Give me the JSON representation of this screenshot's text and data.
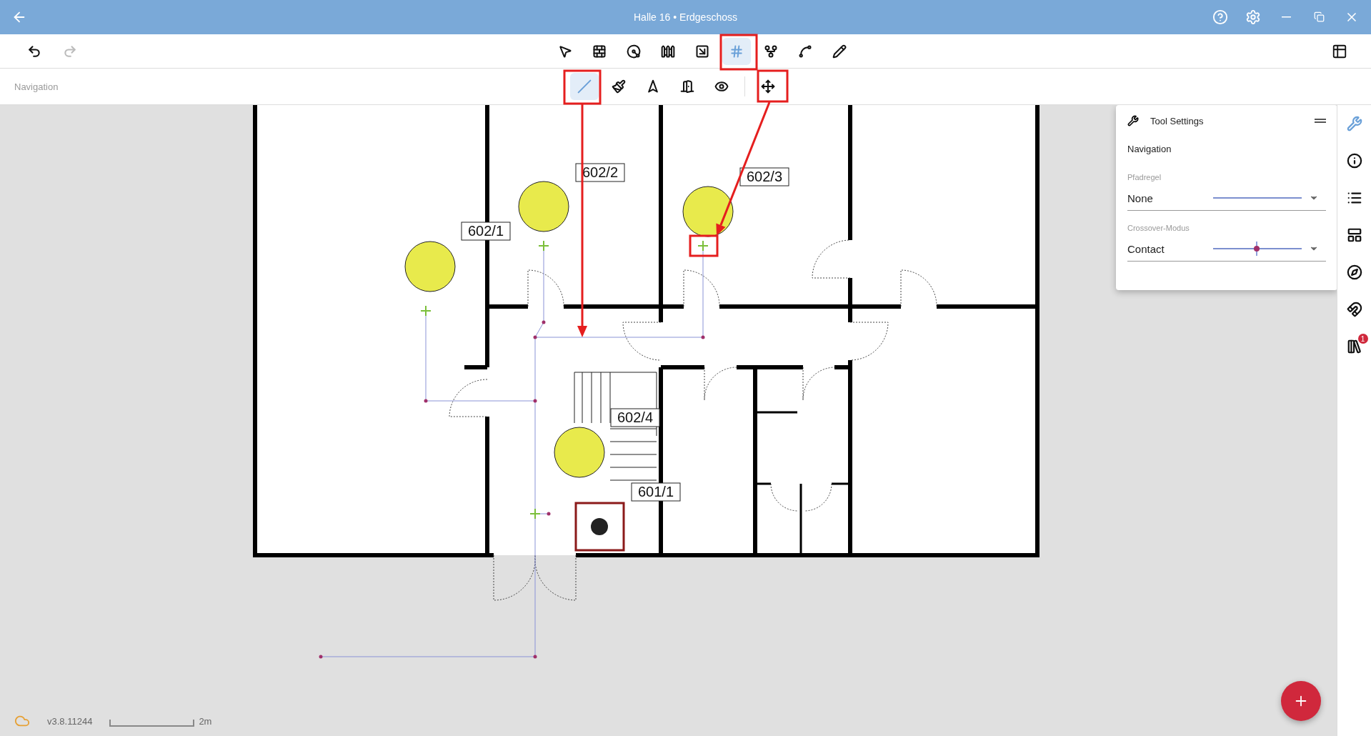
{
  "window": {
    "title": "Halle 16 • Erdgeschoss"
  },
  "history": [
    {
      "kind": "undo",
      "disabled": false
    },
    {
      "kind": "redo",
      "disabled": true
    }
  ],
  "tools": [
    {
      "selected": false
    },
    {
      "selected": false
    },
    {
      "selected": false
    },
    {
      "selected": false
    },
    {
      "selected": false
    },
    {
      "selected": true
    },
    {
      "selected": false
    },
    {
      "selected": false
    },
    {
      "selected": false
    }
  ],
  "mode_label": "Navigation",
  "sub_tools": [
    {
      "selected": true
    },
    {
      "selected": false
    },
    {
      "selected": false
    },
    {
      "selected": false
    },
    {
      "selected": false
    },
    {
      "selected": false
    }
  ],
  "tool_settings": {
    "title": "Tool Settings",
    "section": "Navigation",
    "fields": [
      {
        "label": "Pfadregel",
        "value": "None",
        "kind": "line"
      },
      {
        "label": "Crossover-Modus",
        "value": "Contact",
        "kind": "crossing"
      }
    ]
  },
  "side_panel": [
    {
      "selected": true
    },
    {
      "selected": false
    },
    {
      "selected": false
    },
    {
      "selected": false
    },
    {
      "selected": false
    },
    {
      "selected": false
    },
    {
      "selected": false,
      "badge": "1"
    }
  ],
  "plan": {
    "rooms": [
      {
        "label": "602/1"
      },
      {
        "label": "602/2"
      },
      {
        "label": "602/3"
      },
      {
        "label": "602/4"
      },
      {
        "label": "601/1"
      }
    ]
  },
  "status": {
    "version": "v3.8.11244",
    "scale": "2m"
  }
}
